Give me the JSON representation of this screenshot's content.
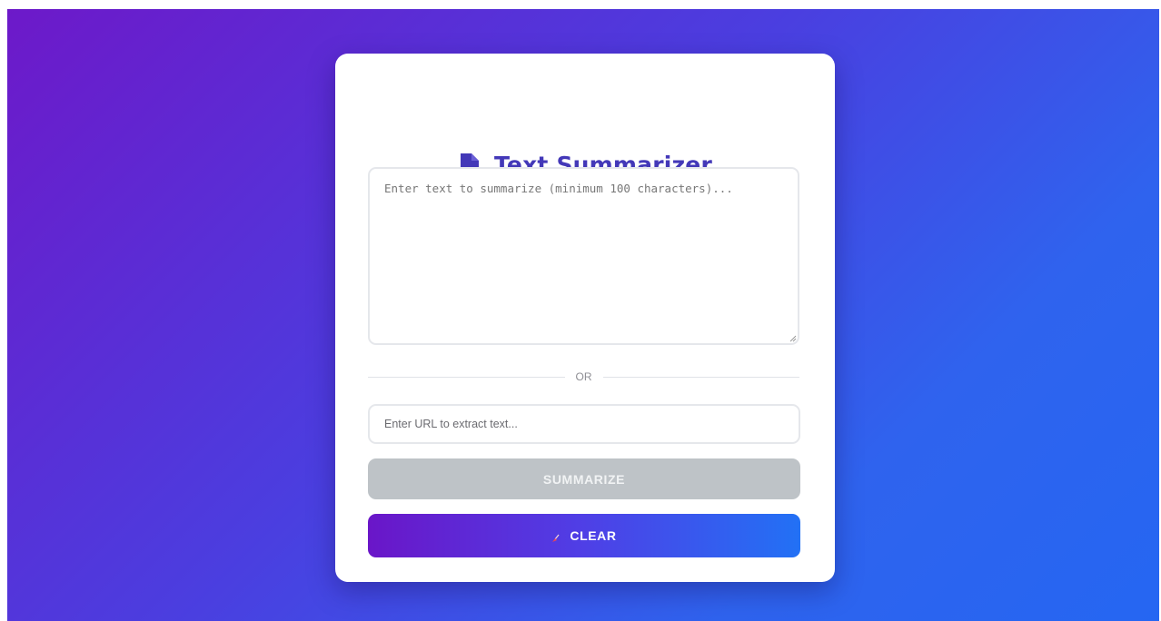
{
  "app": {
    "title": "Text Summarizer",
    "title_icon": "document-icon",
    "accent_color": "#4338b8"
  },
  "form": {
    "text_placeholder": "Enter text to summarize (minimum 100 characters)...",
    "text_value": "",
    "divider_label": "OR",
    "url_placeholder": "Enter URL to extract text...",
    "url_value": ""
  },
  "buttons": {
    "summarize_label": "SUMMARIZE",
    "summarize_disabled": true,
    "clear_label": "CLEAR",
    "clear_icon": "broom-icon"
  },
  "colors": {
    "background_start": "#6d19c9",
    "background_end": "#2566f2",
    "summarize_disabled_bg": "#bec3c7",
    "clear_gradient_start": "#6a16c8",
    "clear_gradient_end": "#2271f5"
  }
}
